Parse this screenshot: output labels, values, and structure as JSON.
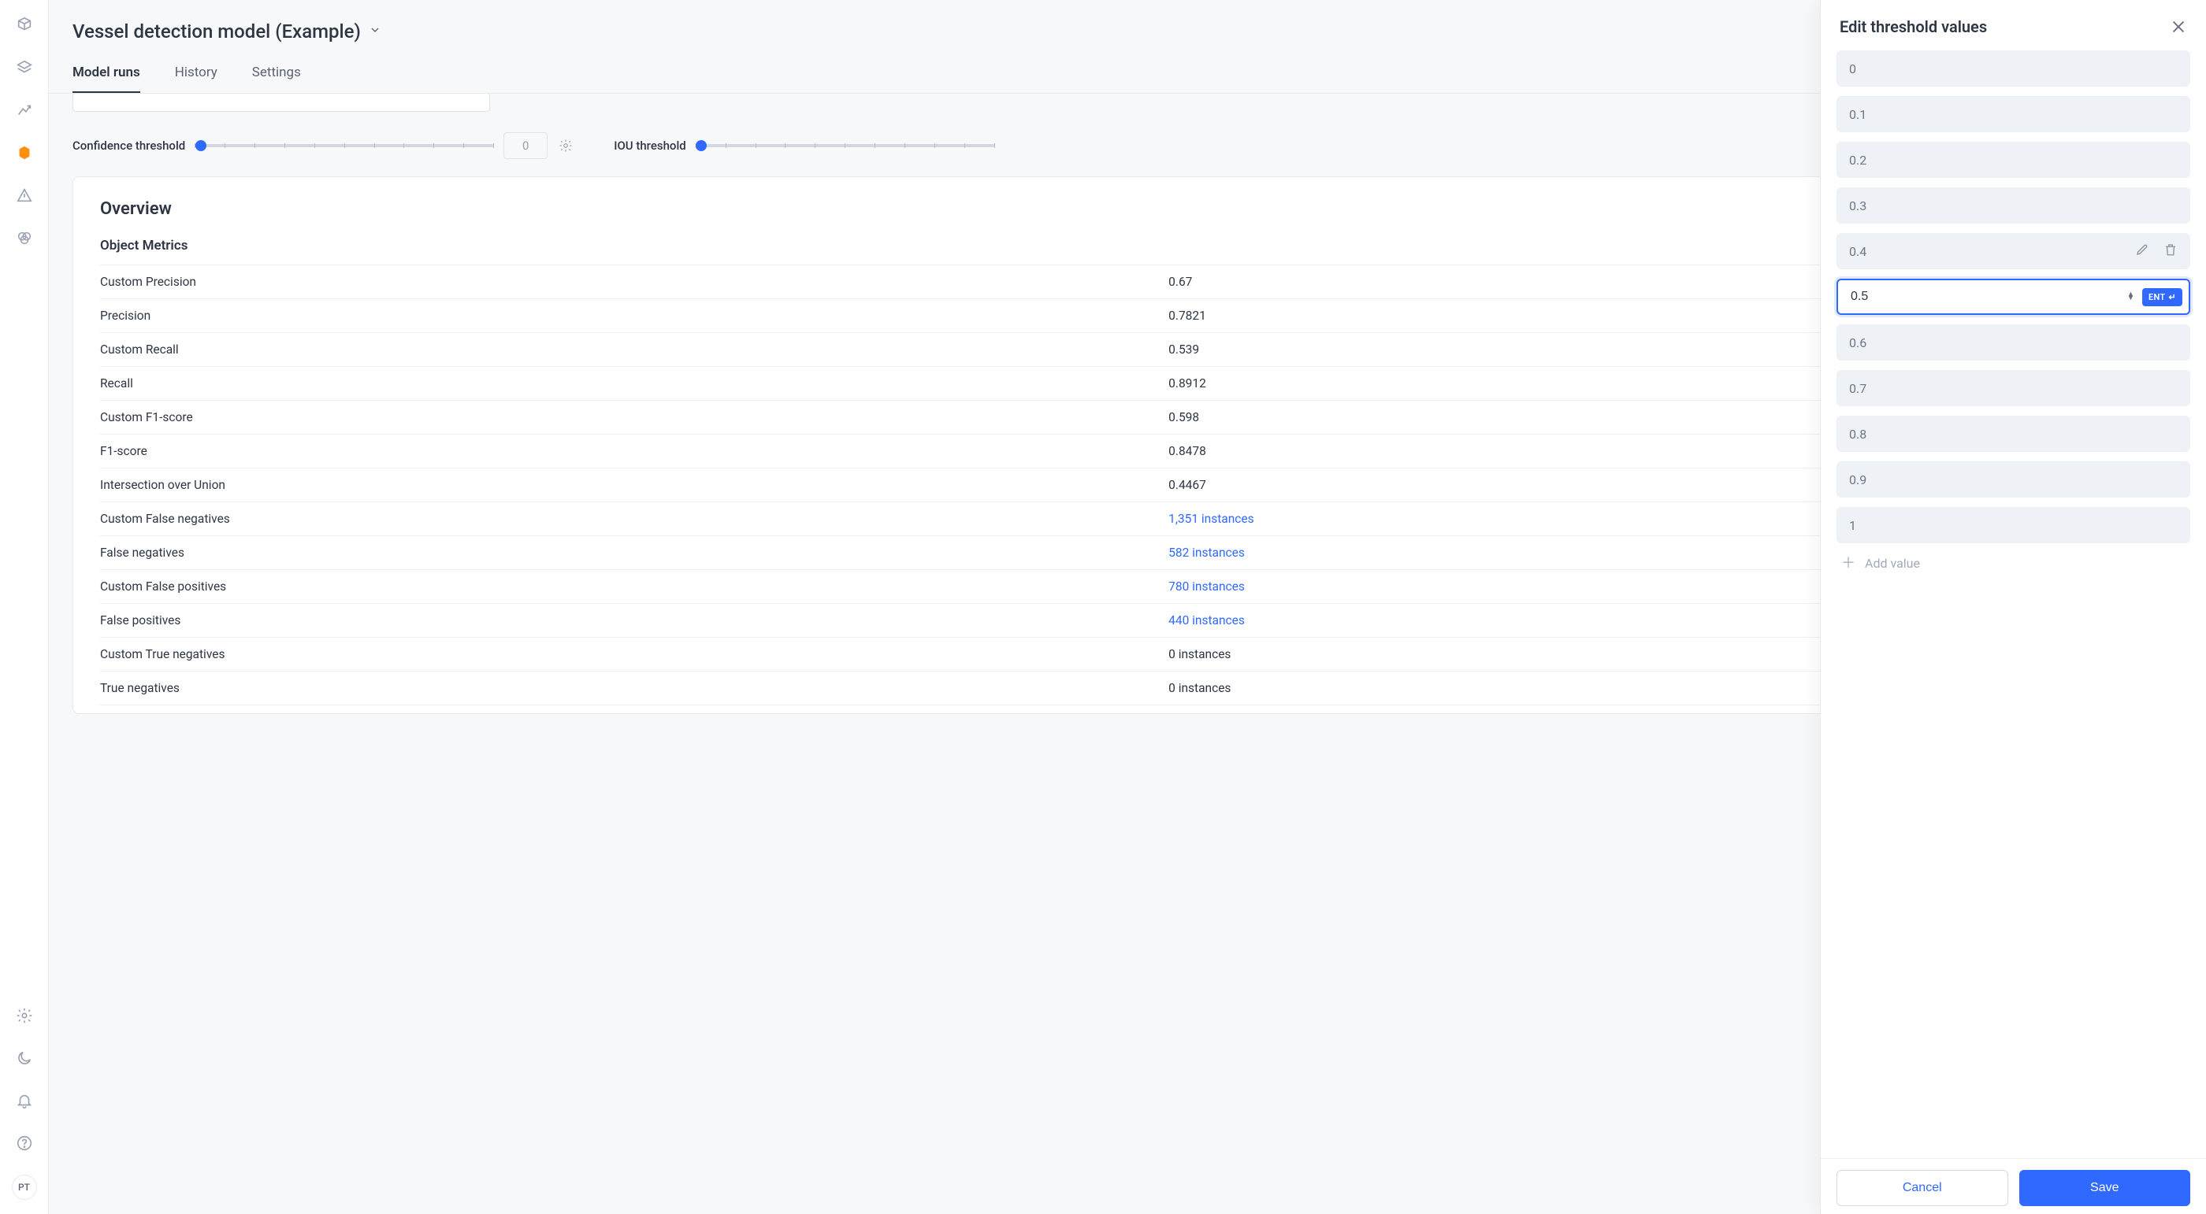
{
  "sidebar": {
    "avatar_initials": "PT"
  },
  "header": {
    "project_title": "Vessel detection model (Example)",
    "tabs": {
      "model_runs": "Model runs",
      "history": "History",
      "settings": "Settings"
    }
  },
  "controls": {
    "confidence_label": "Confidence threshold",
    "confidence_value_display": "0",
    "iou_label": "IOU threshold"
  },
  "overview": {
    "title": "Overview",
    "section_title": "Object Metrics",
    "rows": [
      {
        "label": "Custom Precision",
        "value": "0.67",
        "link": false
      },
      {
        "label": "Precision",
        "value": "0.7821",
        "link": false
      },
      {
        "label": "Custom Recall",
        "value": "0.539",
        "link": false
      },
      {
        "label": "Recall",
        "value": "0.8912",
        "link": false
      },
      {
        "label": "Custom F1-score",
        "value": "0.598",
        "link": false
      },
      {
        "label": "F1-score",
        "value": "0.8478",
        "link": false
      },
      {
        "label": "Intersection over Union",
        "value": "0.4467",
        "link": false
      },
      {
        "label": "Custom False negatives",
        "value": "1,351 instances",
        "link": true
      },
      {
        "label": "False negatives",
        "value": "582 instances",
        "link": true
      },
      {
        "label": "Custom False positives",
        "value": "780 instances",
        "link": true
      },
      {
        "label": "False positives",
        "value": "440 instances",
        "link": true
      },
      {
        "label": "Custom True negatives",
        "value": "0 instances",
        "link": false
      },
      {
        "label": "True negatives",
        "value": "0 instances",
        "link": false
      }
    ]
  },
  "panel": {
    "title": "Edit threshold values",
    "values": [
      "0",
      "0.1",
      "0.2",
      "0.3",
      "0.4",
      "0.5",
      "0.6",
      "0.7",
      "0.8",
      "0.9",
      "1"
    ],
    "hover_index": 4,
    "editing_index": 5,
    "ent_label": "ENT",
    "add_label": "Add value",
    "cancel_label": "Cancel",
    "save_label": "Save"
  }
}
